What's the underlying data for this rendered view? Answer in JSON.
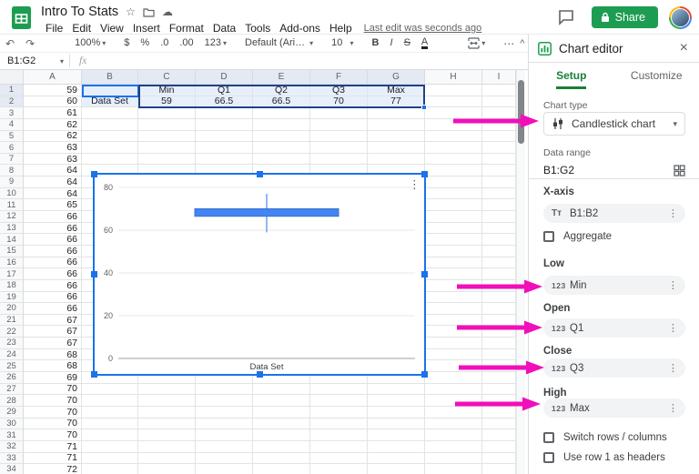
{
  "titlebar": {
    "doc_title": "Intro To Stats",
    "menus": [
      "File",
      "Edit",
      "View",
      "Insert",
      "Format",
      "Data",
      "Tools",
      "Add-ons",
      "Help"
    ],
    "last_edit": "Last edit was seconds ago",
    "share_label": "Share"
  },
  "icons": {
    "star": "☆",
    "cloud": "☁",
    "undo": "↶",
    "redo": "↷",
    "dropdown": "▾",
    "more_h": "⋯",
    "more_v": "⋮",
    "collapse": "^",
    "close": "×"
  },
  "toolbar": {
    "zoom_value": "100%",
    "currency": "$",
    "percent": "%",
    "decimal_decrease": ".0",
    "decimal_increase": ".00",
    "more_formats": "123",
    "font_name": "Default (Ari…",
    "font_size": "10",
    "bold": "B",
    "italic": "I",
    "strikethrough": "S",
    "text_color": "A"
  },
  "formula_bar": {
    "name_box": "B1:G2",
    "fx_label": "fx"
  },
  "grid": {
    "columns": [
      "A",
      "B",
      "C",
      "D",
      "E",
      "F",
      "G",
      "H",
      "I"
    ],
    "col_a_values": [
      59,
      60,
      61,
      62,
      62,
      63,
      63,
      64,
      64,
      64,
      65,
      66,
      66,
      66,
      66,
      66,
      66,
      66,
      66,
      66,
      67,
      67,
      67,
      68,
      68,
      69,
      70,
      70,
      70,
      70,
      70,
      71,
      71,
      72
    ],
    "header_row": {
      "values": [
        "Min",
        "Q1",
        "Q2",
        "Q3",
        "Max"
      ]
    },
    "data_row": {
      "b_label": "Data Set",
      "values": [
        "59",
        "66.5",
        "66.5",
        "70",
        "77"
      ]
    }
  },
  "chart_data": {
    "type": "candlestick",
    "categories": [
      "Data Set"
    ],
    "series": [
      {
        "name": "Data Set",
        "low": 59,
        "open": 66.5,
        "close": 70,
        "high": 77
      }
    ],
    "title": "",
    "xlabel": "Data Set",
    "ylabel": "",
    "ylim": [
      0,
      80
    ],
    "yticks": [
      0,
      20,
      40,
      60,
      80
    ],
    "grid": true,
    "legend": "none"
  },
  "chart_editor": {
    "title": "Chart editor",
    "tabs": [
      {
        "label": "Setup",
        "active": true
      },
      {
        "label": "Customize",
        "active": false
      }
    ],
    "chart_type_label": "Chart type",
    "chart_type_value": "Candlestick chart",
    "data_range_label": "Data range",
    "data_range_value": "B1:G2",
    "x_axis_label": "X-axis",
    "x_axis_value": "B1:B2",
    "x_axis_icon": "Tᴛ",
    "number_icon": "123",
    "aggregate_label": "Aggregate",
    "fields": [
      {
        "label": "Low",
        "value": "Min"
      },
      {
        "label": "Open",
        "value": "Q1"
      },
      {
        "label": "Close",
        "value": "Q3"
      },
      {
        "label": "High",
        "value": "Max"
      }
    ],
    "checkboxes": [
      "Switch rows / columns",
      "Use row 1 as headers"
    ]
  },
  "colors": {
    "accent_blue": "#1a73e8",
    "sheets_green": "#188038",
    "share_green": "#1d9d51",
    "candle_fill": "#4285f4",
    "candle_stroke": "#3c6fd1",
    "whisker_blue": "#6f9ff2",
    "arrow_pink": "#f10fb9",
    "range_dark": "#1f4387",
    "sel_tint": "#e7effd"
  }
}
